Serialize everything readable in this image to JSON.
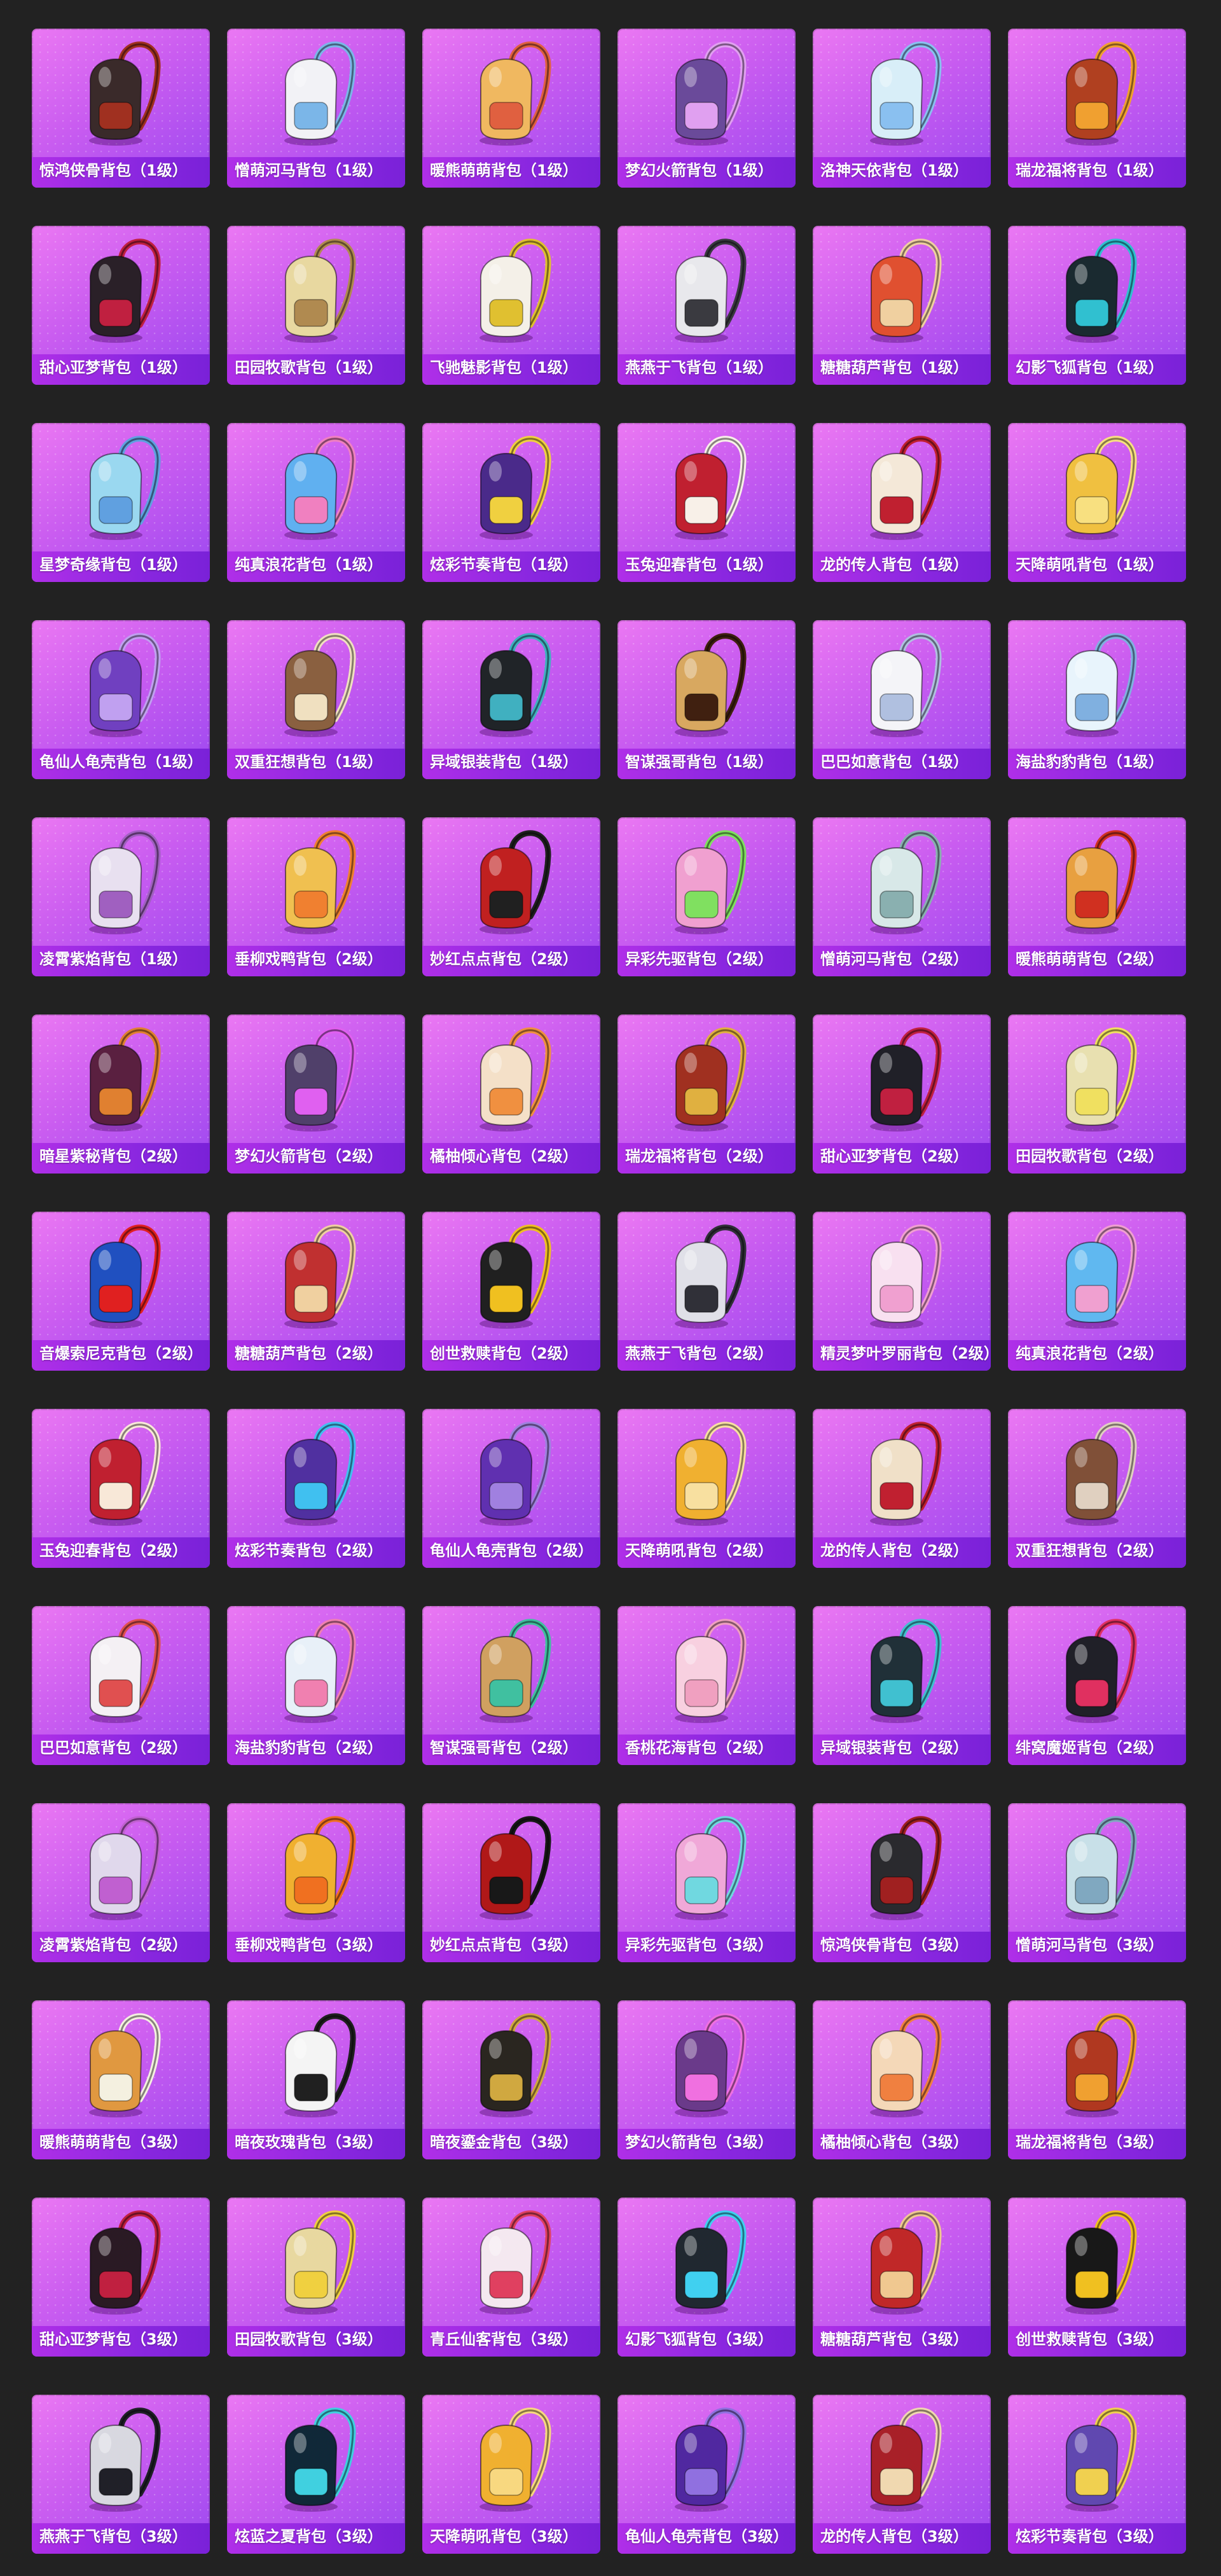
{
  "items": [
    {
      "name": "惊鸿侠骨背包（1级）",
      "color": "#3a2a2a",
      "accent": "#a03020"
    },
    {
      "name": "憎萌河马背包（1级）",
      "color": "#f2f2f6",
      "accent": "#7bb6e8"
    },
    {
      "name": "暖熊萌萌背包（1级）",
      "color": "#f0b860",
      "accent": "#e06040"
    },
    {
      "name": "梦幻火箭背包（1级）",
      "color": "#6a4a9a",
      "accent": "#e0a0f0"
    },
    {
      "name": "洛神天依背包（1级）",
      "color": "#d8eef8",
      "accent": "#8ac0f0"
    },
    {
      "name": "瑞龙福将背包（1级）",
      "color": "#b04020",
      "accent": "#f0a030"
    },
    {
      "name": "甜心亚梦背包（1级）",
      "color": "#2a2028",
      "accent": "#c02040"
    },
    {
      "name": "田园牧歌背包（1级）",
      "color": "#e8d8a0",
      "accent": "#b08a50"
    },
    {
      "name": "飞驰魅影背包（1级）",
      "color": "#f4f0e8",
      "accent": "#e0c030"
    },
    {
      "name": "燕燕于飞背包（1级）",
      "color": "#e8e8ec",
      "accent": "#3a3a40"
    },
    {
      "name": "糖糖葫芦背包（1级）",
      "color": "#e05030",
      "accent": "#f0d0a0"
    },
    {
      "name": "幻影飞狐背包（1级）",
      "color": "#1a2a30",
      "accent": "#30c0d0"
    },
    {
      "name": "星梦奇缘背包（1级）",
      "color": "#9ad8f0",
      "accent": "#60a0e0"
    },
    {
      "name": "纯真浪花背包（1级）",
      "color": "#60b0f0",
      "accent": "#f080c0"
    },
    {
      "name": "炫彩节奏背包（1级）",
      "color": "#4a2a8a",
      "accent": "#f0d040"
    },
    {
      "name": "玉兔迎春背包（1级）",
      "color": "#c02030",
      "accent": "#f8f0e8"
    },
    {
      "name": "龙的传人背包（1级）",
      "color": "#f4e8d8",
      "accent": "#c02030"
    },
    {
      "name": "天降萌吼背包（1级）",
      "color": "#f0c040",
      "accent": "#f8e080"
    },
    {
      "name": "龟仙人龟壳背包（1级）",
      "color": "#7040c0",
      "accent": "#c0a0f0"
    },
    {
      "name": "双重狂想背包（1级）",
      "color": "#8a6040",
      "accent": "#f0e0c0"
    },
    {
      "name": "异域银装背包（1级）",
      "color": "#202428",
      "accent": "#40b0c0"
    },
    {
      "name": "智谋强哥背包（1级）",
      "color": "#d8a860",
      "accent": "#402010"
    },
    {
      "name": "巴巴如意背包（1级）",
      "color": "#f4f4f8",
      "accent": "#b0c0e0"
    },
    {
      "name": "海盐豹豹背包（1级）",
      "color": "#e8f4fc",
      "accent": "#80b0e0"
    },
    {
      "name": "凌霄紫焰背包（1级）",
      "color": "#e8e0f0",
      "accent": "#a060c0"
    },
    {
      "name": "垂柳戏鸭背包（2级）",
      "color": "#f0c050",
      "accent": "#f08030"
    },
    {
      "name": "妙红点点背包（2级）",
      "color": "#c02020",
      "accent": "#202020"
    },
    {
      "name": "异彩先驱背包（2级）",
      "color": "#f0a0d0",
      "accent": "#80e060"
    },
    {
      "name": "憎萌河马背包（2级）",
      "color": "#d8e8e8",
      "accent": "#8ab0b0"
    },
    {
      "name": "暖熊萌萌背包（2级）",
      "color": "#e8a040",
      "accent": "#d03020"
    },
    {
      "name": "暗星紫秘背包（2级）",
      "color": "#5a2040",
      "accent": "#e08030"
    },
    {
      "name": "梦幻火箭背包（2级）",
      "color": "#50406a",
      "accent": "#e060f0"
    },
    {
      "name": "橘柚倾心背包（2级）",
      "color": "#f4e0c8",
      "accent": "#f09040"
    },
    {
      "name": "瑞龙福将背包（2级）",
      "color": "#a03020",
      "accent": "#e0b040"
    },
    {
      "name": "甜心亚梦背包（2级）",
      "color": "#202028",
      "accent": "#c02040"
    },
    {
      "name": "田园牧歌背包（2级）",
      "color": "#e8e0b0",
      "accent": "#f0e060"
    },
    {
      "name": "音爆索尼克背包（2级）",
      "color": "#2050c0",
      "accent": "#e02020"
    },
    {
      "name": "糖糖葫芦背包（2级）",
      "color": "#c03030",
      "accent": "#f0d0a0"
    },
    {
      "name": "创世救赎背包（2级）",
      "color": "#202020",
      "accent": "#f0c020"
    },
    {
      "name": "燕燕于飞背包（2级）",
      "color": "#e0e0e8",
      "accent": "#303038"
    },
    {
      "name": "精灵梦叶罗丽背包（2级）",
      "color": "#f8e0f0",
      "accent": "#f0a0d0"
    },
    {
      "name": "纯真浪花背包（2级）",
      "color": "#60b8f0",
      "accent": "#f0a0d0"
    },
    {
      "name": "玉兔迎春背包（2级）",
      "color": "#c02030",
      "accent": "#f8e8d8"
    },
    {
      "name": "炫彩节奏背包（2级）",
      "color": "#5030a0",
      "accent": "#40c0f0"
    },
    {
      "name": "龟仙人龟壳背包（2级）",
      "color": "#6030b0",
      "accent": "#a080e0"
    },
    {
      "name": "天降萌吼背包（2级）",
      "color": "#f0b030",
      "accent": "#f8e0a0"
    },
    {
      "name": "龙的传人背包（2级）",
      "color": "#f0e0c8",
      "accent": "#c02030"
    },
    {
      "name": "双重狂想背包（2级）",
      "color": "#805038",
      "accent": "#e0d0c0"
    },
    {
      "name": "巴巴如意背包（2级）",
      "color": "#f4f0f4",
      "accent": "#e05050"
    },
    {
      "name": "海盐豹豹背包（2级）",
      "color": "#e8f0f8",
      "accent": "#f080b0"
    },
    {
      "name": "智谋强哥背包（2级）",
      "color": "#d0a060",
      "accent": "#40c0a0"
    },
    {
      "name": "香桃花海背包（2级）",
      "color": "#f8d0e0",
      "accent": "#f0a0c0"
    },
    {
      "name": "异域银装背包（2级）",
      "color": "#203038",
      "accent": "#40c0d0"
    },
    {
      "name": "绯窝魔姬背包（2级）",
      "color": "#202028",
      "accent": "#e03060"
    },
    {
      "name": "凌霄紫焰背包（2级）",
      "color": "#e0d8ec",
      "accent": "#c060d0"
    },
    {
      "name": "垂柳戏鸭背包（3级）",
      "color": "#f0b030",
      "accent": "#f07020"
    },
    {
      "name": "妙红点点背包（3级）",
      "color": "#b01818",
      "accent": "#181818"
    },
    {
      "name": "异彩先驱背包（3级）",
      "color": "#f0a8d8",
      "accent": "#70d8e0"
    },
    {
      "name": "惊鸿侠骨背包（3级）",
      "color": "#2a2a2e",
      "accent": "#a02020"
    },
    {
      "name": "憎萌河马背包（3级）",
      "color": "#c8e0e8",
      "accent": "#80a8c0"
    },
    {
      "name": "暖熊萌萌背包（3级）",
      "color": "#e09840",
      "accent": "#f4f0e0"
    },
    {
      "name": "暗夜玫瑰背包（3级）",
      "color": "#f4f4f4",
      "accent": "#202020"
    },
    {
      "name": "暗夜鎏金背包（3级）",
      "color": "#2a2620",
      "accent": "#d0a840"
    },
    {
      "name": "梦幻火箭背包（3级）",
      "color": "#6a3a8a",
      "accent": "#f070e0"
    },
    {
      "name": "橘柚倾心背包（3级）",
      "color": "#f4d8b8",
      "accent": "#f08040"
    },
    {
      "name": "瑞龙福将背包（3级）",
      "color": "#b03820",
      "accent": "#f0a030"
    },
    {
      "name": "甜心亚梦背包（3级）",
      "color": "#2a1a24",
      "accent": "#c02040"
    },
    {
      "name": "田园牧歌背包（3级）",
      "color": "#e8d8a0",
      "accent": "#f0d040"
    },
    {
      "name": "青丘仙客背包（3级）",
      "color": "#f4e8f0",
      "accent": "#e04060"
    },
    {
      "name": "幻影飞狐背包（3级）",
      "color": "#202830",
      "accent": "#40d0f0"
    },
    {
      "name": "糖糖葫芦背包（3级）",
      "color": "#c02828",
      "accent": "#f0c890"
    },
    {
      "name": "创世救赎背包（3级）",
      "color": "#181818",
      "accent": "#f0c020"
    },
    {
      "name": "燕燕于飞背包（3级）",
      "color": "#d8d8e0",
      "accent": "#202028"
    },
    {
      "name": "炫蓝之夏背包（3级）",
      "color": "#102838",
      "accent": "#40d0e0"
    },
    {
      "name": "天降萌吼背包（3级）",
      "color": "#f0b030",
      "accent": "#f8d880"
    },
    {
      "name": "龟仙人龟壳背包（3级）",
      "color": "#5028a0",
      "accent": "#9070e0"
    },
    {
      "name": "龙的传人背包（3级）",
      "color": "#a82028",
      "accent": "#f0d8b0"
    },
    {
      "name": "炫彩节奏背包（3级）",
      "color": "#6048b0",
      "accent": "#f0d050"
    }
  ]
}
